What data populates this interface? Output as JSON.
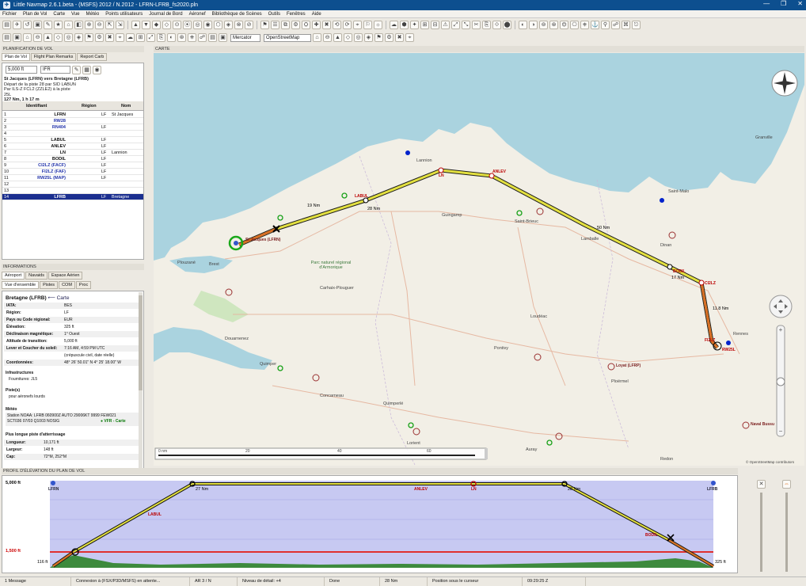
{
  "window": {
    "title": "Little Navmap 2.6.1.beta - (MSFS) 2012 / N.2012 - LFRN-LFRB_fs2020.pln",
    "controls": [
      "—",
      "❐",
      "✕"
    ]
  },
  "menu": [
    "Fichier",
    "Plan de Vol",
    "Carte",
    "Vue",
    "Météo",
    "Points utilisateurs",
    "Journal de Bord",
    "Aéronef",
    "Bibliothèque de Scènes",
    "Outils",
    "Fenêtres",
    "Aide"
  ],
  "toolbar": {
    "map_theme": "Mercator",
    "map_source": "OpenStreetMap"
  },
  "flightplan_panel": {
    "title": "PLANIFICATION DE VOL",
    "tabs": [
      "Plan de Vol",
      "Flight Plan Remarks",
      "Report Carb"
    ],
    "altitude": "5,000 ft",
    "type": "IFR",
    "route_title": "St Jacques (LFRN) vers Bretagne (LFRB)",
    "route_line2": "Départ de la piste 28 par SID LABUN",
    "route_line3": "Par ILS-Z FCL2 (ZZLE2) à la piste",
    "route_line4": "25L",
    "route_line5": "127 Nm, 1 h 17 m",
    "columns": [
      "Identifiant",
      "Région",
      "Nom"
    ],
    "rows": [
      {
        "num": "1",
        "ident": "LFRN",
        "region": "LF",
        "name": "St Jacques"
      },
      {
        "num": "2",
        "ident": "RW28",
        "region": "",
        "name": ""
      },
      {
        "num": "3",
        "ident": "RN404",
        "region": "LF",
        "name": ""
      },
      {
        "num": "4",
        "ident": "",
        "region": "",
        "name": ""
      },
      {
        "num": "5",
        "ident": "LABUL",
        "region": "LF",
        "name": ""
      },
      {
        "num": "6",
        "ident": "ANLEV",
        "region": "LF",
        "name": ""
      },
      {
        "num": "7",
        "ident": "LN",
        "region": "LF",
        "name": "Lannion"
      },
      {
        "num": "8",
        "ident": "BODIL",
        "region": "LF",
        "name": ""
      },
      {
        "num": "9",
        "ident": "CI2LZ (FACF)",
        "region": "LF",
        "name": ""
      },
      {
        "num": "10",
        "ident": "FI2LZ (FAF)",
        "region": "LF",
        "name": ""
      },
      {
        "num": "11",
        "ident": "RW25L (MAP)",
        "region": "LF",
        "name": ""
      },
      {
        "num": "12",
        "ident": "",
        "region": "",
        "name": ""
      },
      {
        "num": "13",
        "ident": "",
        "region": "",
        "name": ""
      },
      {
        "num": "14",
        "ident": "LFRB",
        "region": "LF",
        "name": "Bretagne"
      }
    ]
  },
  "info_panel": {
    "title": "INFORMATIONS",
    "tabs1": [
      "Aéroport",
      "Navaids",
      "Espace Aérien"
    ],
    "tabs2": [
      "Vue d'ensemble",
      "Pistes",
      "COM",
      "Proc"
    ],
    "airport": "Bretagne (LFRB)",
    "map_link": "Carte",
    "fields": [
      {
        "k": "IATA:",
        "v": "BES"
      },
      {
        "k": "Région:",
        "v": "LF"
      },
      {
        "k": "Pays ou Code régional:",
        "v": "EUR"
      },
      {
        "k": "Élévation:",
        "v": "325 ft"
      },
      {
        "k": "Déclinaison magnétique:",
        "v": "1° Ouest"
      },
      {
        "k": "Altitude de transition:",
        "v": "5,000 ft"
      },
      {
        "k": "Lever et Coucher du soleil:",
        "v": "7:16 AM, 4:59 PM UTC"
      },
      {
        "k": "",
        "v": "(crépuscule civil, date réelle)"
      },
      {
        "k": "Coordonnées:",
        "v": "48° 26' 50.01\" N 4° 25' 18.00\" W"
      }
    ],
    "infra_title": "Infrastructures",
    "infra": "Fournitures: JL5",
    "pistes_title": "Piste(s)",
    "pistes": "pour aéronefs lourds",
    "meteo_title": "Météo",
    "station": "Station NOAA: LFRB 060900Z AUTO 29006KT 9999 FEW021",
    "station2": "SCT036 07/03 Q1003 NOSIG",
    "vfr": "VFR - Carte",
    "longest_title": "Plus longue piste d'atterrissage",
    "longest": [
      {
        "k": "Longueur:",
        "v": "10,171 ft"
      },
      {
        "k": "Largeur:",
        "v": "148 ft"
      },
      {
        "k": "Cap:",
        "v": "72°M, 252°M"
      }
    ]
  },
  "map_panel": {
    "title": "CARTE",
    "places": [
      "Brest",
      "Plouzané",
      "Lannion",
      "Guingamp",
      "Saint-Brieuc",
      "Lamballe",
      "Dinan",
      "Saint-Malo",
      "Granville",
      "Rennes",
      "Carhaix-Plouguer",
      "Pontivy",
      "Loudéac",
      "Ploërmel",
      "Quimper",
      "Quimperlé",
      "Concarneau",
      "Douarnenez",
      "Lorient",
      "Auray",
      "Redon",
      "Parc naturel régional d'Armorique"
    ],
    "waypoints": [
      "LABUL",
      "ANLEV",
      "LN",
      "BODIL",
      "CI2LZ",
      "FI2LZ",
      "RW25L"
    ],
    "leg_labels": [
      "19 Nm",
      "28 Nm",
      "50 Nm",
      "17 Nm",
      "11.8 Nm"
    ],
    "airports": [
      "St Jacques (LFRN)",
      "Loyat (LFRP)",
      "Naval Bussu"
    ],
    "scale": [
      "0 nm",
      "20",
      "40",
      "60"
    ],
    "attribution": "© OpenStreetMap contributors"
  },
  "profile_panel": {
    "title": "PROFIL D'ÉLÉVATION DU PLAN DE VOL",
    "alt_top": "5,000 ft",
    "alt_safe": "1,500 ft",
    "start_alt": "116 ft",
    "end_alt": "325 ft",
    "labels": [
      "LFRN",
      "LABUL",
      "27 Nm",
      "ANLEV",
      "LN",
      "28 Nm",
      "BODIL",
      "LFRB"
    ]
  },
  "status_bar": [
    "1 Message",
    "Connexion à (FSX/P3D/MSFS) en attente...",
    "AR 3 / N",
    "Niveau de détail: +4",
    "Done",
    "28 Nm",
    "Position sous le curseur",
    "09:29:25 Z"
  ]
}
